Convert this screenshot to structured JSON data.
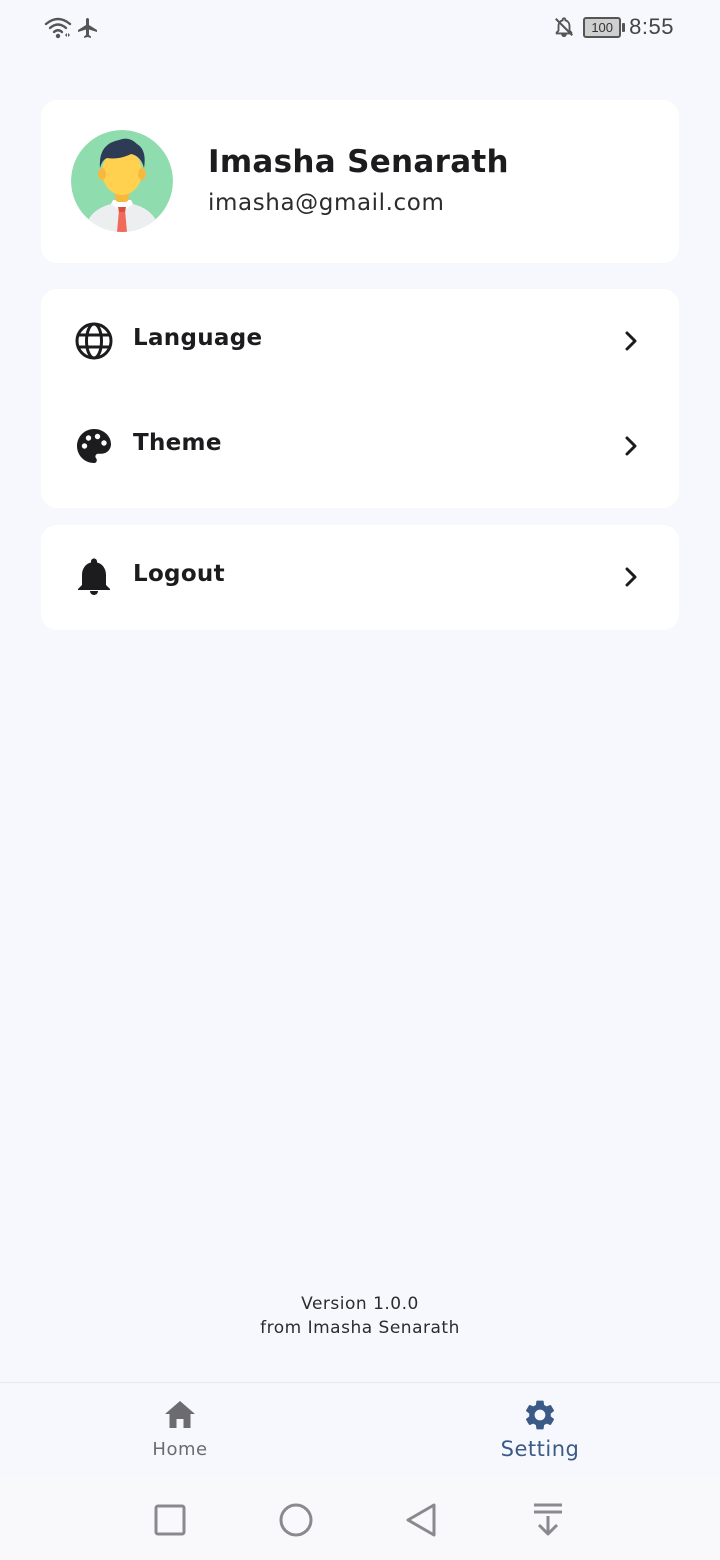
{
  "status_bar": {
    "time": "8:55",
    "battery": "100",
    "icons": [
      "wifi-icon",
      "airplane-icon",
      "notifications-off-icon",
      "battery-icon"
    ]
  },
  "profile": {
    "name": "Imasha Senarath",
    "email": "imasha@gmail.com",
    "avatar_icon": "avatar-icon"
  },
  "menu": {
    "items": [
      {
        "label": "Language",
        "icon": "globe-icon"
      },
      {
        "label": "Theme",
        "icon": "palette-icon"
      }
    ]
  },
  "logout": {
    "label": "Logout",
    "icon": "bell-icon"
  },
  "footer": {
    "version": "Version 1.0.0",
    "credit": "from Imasha Senarath"
  },
  "bottom_nav": {
    "items": [
      {
        "label": "Home",
        "icon": "home-icon",
        "active": false
      },
      {
        "label": "Setting",
        "icon": "gear-icon",
        "active": true
      }
    ],
    "active_color": "#3b5a86",
    "inactive_color": "#6b6b70"
  },
  "system_nav": {
    "icons": [
      "recents-square-icon",
      "home-circle-icon",
      "back-triangle-icon",
      "pull-down-icon"
    ]
  }
}
